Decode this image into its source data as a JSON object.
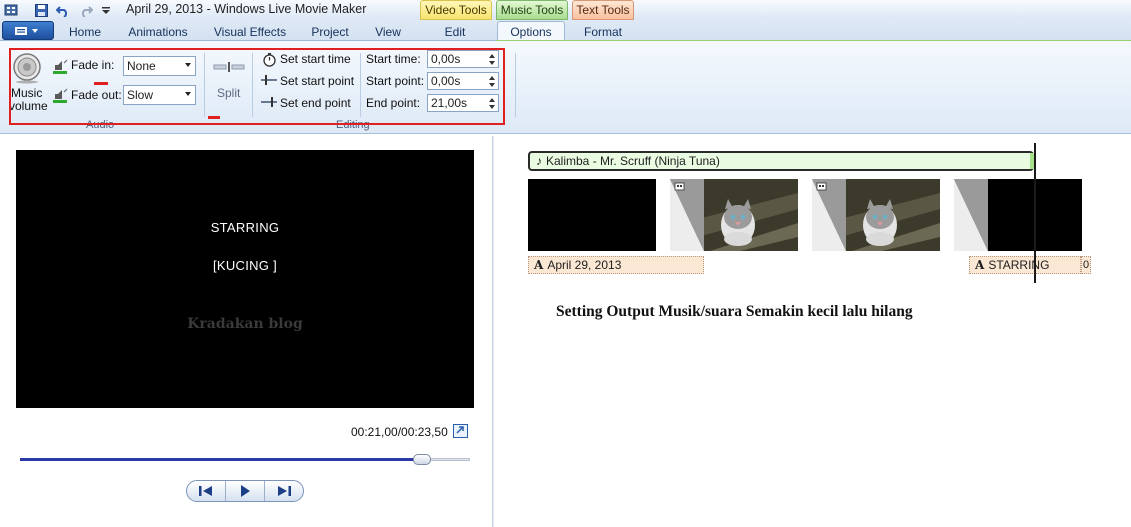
{
  "title_bar": {
    "title": "April 29, 2013 - Windows Live Movie Maker",
    "context_groups": [
      "Video Tools",
      "Music Tools",
      "Text Tools"
    ]
  },
  "tabs": [
    "Home",
    "Animations",
    "Visual Effects",
    "Project",
    "View",
    "Edit",
    "Options",
    "Format"
  ],
  "active_tab": "Options",
  "ribbon": {
    "audio_group": {
      "label": "Audio",
      "music_volume_line1": "Music",
      "music_volume_line2": "volume",
      "fade_in_label": "Fade in:",
      "fade_in_value": "None",
      "fade_out_label": "Fade out:",
      "fade_out_value": "Slow"
    },
    "editing_group": {
      "label": "Editing",
      "split_label": "Split",
      "set_start_time": "Set start time",
      "set_start_point": "Set start point",
      "set_end_point": "Set end point",
      "start_time_label": "Start time:",
      "start_time_value": "0,00s",
      "start_point_label": "Start point:",
      "start_point_value": "0,00s",
      "end_point_label": "End point:",
      "end_point_value": "21,00s"
    }
  },
  "preview": {
    "line1": "STARRING",
    "line2": "[KUCING ]",
    "watermark": "Kradakan blog",
    "timecode": "00:21,00/00:23,50",
    "seek_progress": 0.894
  },
  "storyboard": {
    "music_clip": "Kalimba - Mr. Scruff (Ninja Tuna)",
    "captions": [
      "April 29, 2013",
      "STARRING"
    ],
    "overflow_caption": "0"
  },
  "annotation": "Setting Output Musik/suara Semakin kecil lalu hilang",
  "colors": {
    "highlight": "#e02020",
    "music_tools": "#a8dc8e",
    "video_tools": "#f6e46d",
    "text_tools": "#f7c0a0"
  }
}
